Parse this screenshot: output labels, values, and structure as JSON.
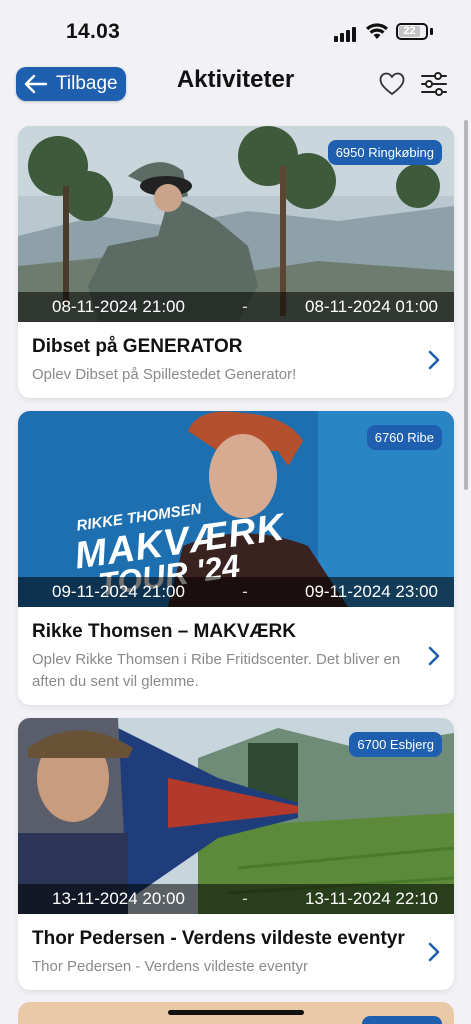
{
  "status_bar": {
    "time": "14.03",
    "battery": "22"
  },
  "nav": {
    "back_label": "Tilbage",
    "title": "Aktiviteter",
    "favorites_icon": "heart-icon",
    "filter_icon": "sliders-icon"
  },
  "accent_color": "#1f5fb0",
  "events": [
    {
      "location": "6950 Ringkøbing",
      "start": "08-11-2024 21:00",
      "separator": "-",
      "end": "08-11-2024 01:00",
      "title": "Dibset på GENERATOR",
      "description": "Oplev Dibset på Spillestedet Generator!"
    },
    {
      "location": "6760 Ribe",
      "start": "09-11-2024 21:00",
      "separator": "-",
      "end": "09-11-2024 23:00",
      "title": "Rikke Thomsen – MAKVÆRK",
      "description": "Oplev Rikke Thomsen i Ribe Fritidscenter. Det bliver en aften du sent vil glemme.",
      "poster_artist": "RIKKE THOMSEN",
      "poster_title": "MAKVÆRK",
      "poster_tour": "TOUR '24"
    },
    {
      "location": "6700 Esbjerg",
      "start": "13-11-2024 20:00",
      "separator": "-",
      "end": "13-11-2024 22:10",
      "title": "Thor Pedersen - Verdens vildeste eventyr",
      "description": "Thor Pedersen - Verdens vildeste eventyr"
    }
  ]
}
